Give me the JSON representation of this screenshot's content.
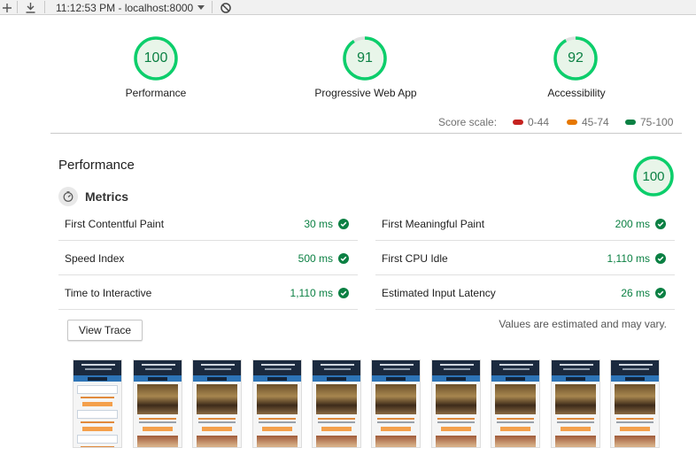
{
  "toolbar": {
    "timestamp": "11:12:53 PM - localhost:8000",
    "icons": [
      "add-icon",
      "download-icon",
      "dropdown-icon",
      "block-icon"
    ]
  },
  "categories": [
    {
      "label": "Performance",
      "score": "100"
    },
    {
      "label": "Progressive Web App",
      "score": "91"
    },
    {
      "label": "Accessibility",
      "score": "92"
    }
  ],
  "score_scale": {
    "label": "Score scale:",
    "ranges": [
      {
        "label": "0-44",
        "color": "#c5221f"
      },
      {
        "label": "45-74",
        "color": "#e67700"
      },
      {
        "label": "75-100",
        "color": "#0b8043"
      }
    ]
  },
  "performance": {
    "title": "Performance",
    "score": "100",
    "metrics_title": "Metrics",
    "metrics": [
      {
        "name": "First Contentful Paint",
        "value": "30 ms"
      },
      {
        "name": "First Meaningful Paint",
        "value": "200 ms"
      },
      {
        "name": "Speed Index",
        "value": "500 ms"
      },
      {
        "name": "First CPU Idle",
        "value": "1,110 ms"
      },
      {
        "name": "Time to Interactive",
        "value": "1,110 ms"
      },
      {
        "name": "Estimated Input Latency",
        "value": "26 ms"
      }
    ],
    "view_trace_label": "View Trace",
    "estimate_note": "Values are estimated and may vary.",
    "filmstrip_frames": 10
  },
  "colors": {
    "pass": "#0b8043",
    "pass_ring": "#0cce6b"
  }
}
